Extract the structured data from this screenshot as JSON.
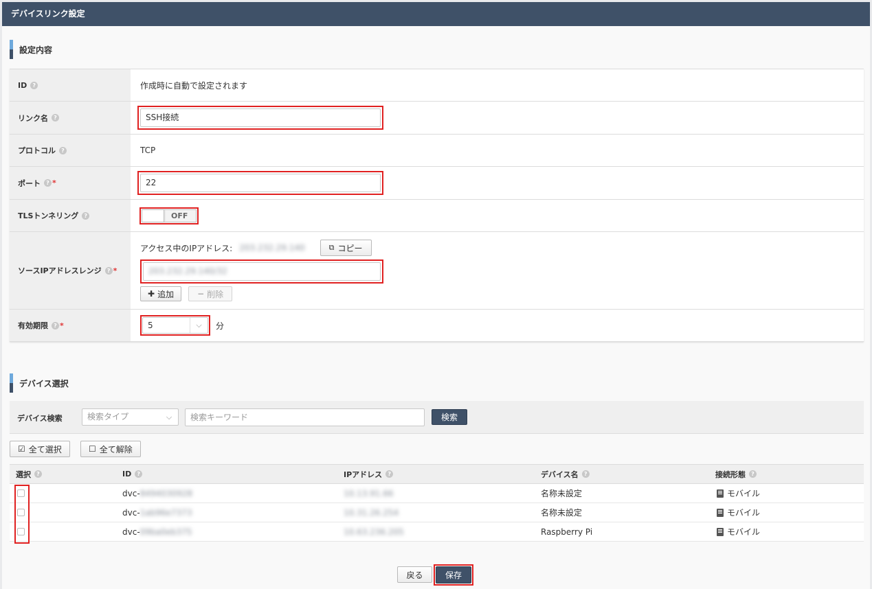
{
  "window": {
    "title": "デバイスリンク設定"
  },
  "settings": {
    "section_title": "設定内容",
    "id": {
      "label": "ID",
      "value": "作成時に自動で設定されます"
    },
    "link_name": {
      "label": "リンク名",
      "value": "SSH接続"
    },
    "protocol": {
      "label": "プロトコル",
      "value": "TCP"
    },
    "port": {
      "label": "ポート",
      "value": "22"
    },
    "tls": {
      "label": "TLSトンネリング",
      "state": "OFF"
    },
    "source_ip": {
      "label": "ソースIPアドレスレンジ",
      "current_ip_label": "アクセス中のIPアドレス:",
      "current_ip": "203.232.29.140",
      "copy_button": "コピー",
      "range_value": "203.232.29.140/32",
      "add_button": "追加",
      "delete_button": "削除"
    },
    "expiry": {
      "label": "有効期限",
      "value": "5",
      "unit": "分"
    }
  },
  "device_select": {
    "section_title": "デバイス選択",
    "search": {
      "label": "デバイス検索",
      "type_placeholder": "検索タイプ",
      "keyword_placeholder": "検索キーワード",
      "button": "検索"
    },
    "select_all": "全て選択",
    "deselect_all": "全て解除",
    "columns": {
      "select": "選択",
      "id": "ID",
      "ip": "IPアドレス",
      "name": "デバイス名",
      "connection": "接続形態"
    },
    "rows": [
      {
        "id_prefix": "dvc-",
        "id_rest": "8494030928",
        "ip": "10.13.91.66",
        "name": "名称未設定",
        "connection": "モバイル"
      },
      {
        "id_prefix": "dvc-",
        "id_rest": "1ab96e7373",
        "ip": "10.31.26.254",
        "name": "名称未設定",
        "connection": "モバイル"
      },
      {
        "id_prefix": "dvc-",
        "id_rest": "09ba0eb375",
        "ip": "10.63.236.205",
        "name": "Raspberry Pi",
        "connection": "モバイル"
      }
    ]
  },
  "footer": {
    "back": "戻る",
    "save": "保存"
  }
}
